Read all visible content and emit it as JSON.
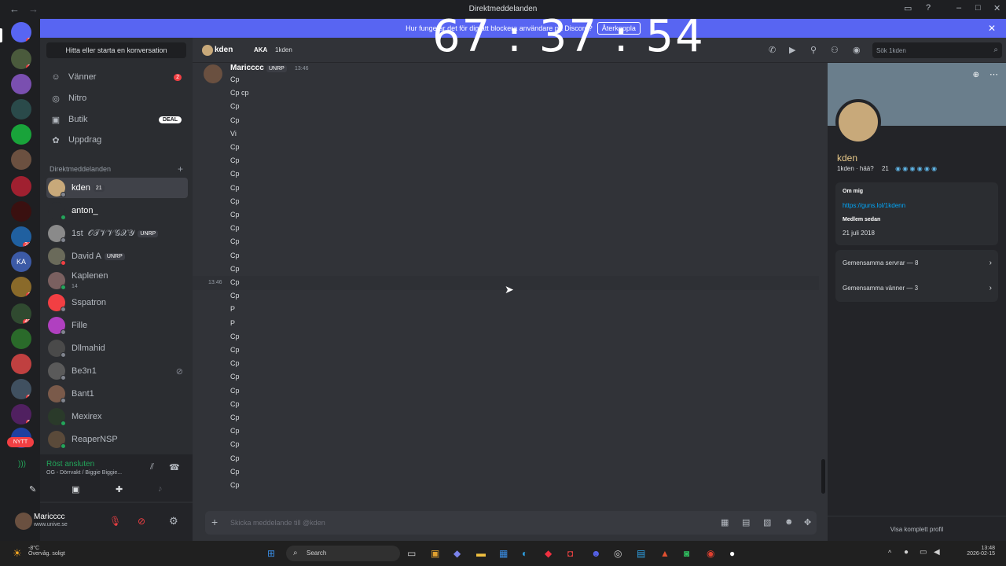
{
  "window": {
    "title": "Direktmeddelanden",
    "back": "←",
    "forward": "→"
  },
  "banner": {
    "text": "Hur fungerar det för dig att blockera användare på Discord?",
    "button": "Återkoppla"
  },
  "overlay_clock": "67 : 37 : 54",
  "rail": {
    "badges": [
      "2",
      "1",
      "34",
      "1",
      "49",
      "8",
      "5"
    ],
    "ka_label": "KA",
    "new_label": "NYTT"
  },
  "dm_panel": {
    "find_label": "Hitta eller starta en konversation",
    "nav": [
      {
        "label": "Vänner",
        "icon": "friends-icon",
        "badge": "2"
      },
      {
        "label": "Nitro",
        "icon": "nitro-icon"
      },
      {
        "label": "Butik",
        "icon": "shop-icon",
        "deal": "DEAL"
      },
      {
        "label": "Uppdrag",
        "icon": "quests-icon"
      }
    ],
    "header": "Direktmeddelanden",
    "items": [
      {
        "name": "kden",
        "tag": "21"
      },
      {
        "name": "anton_"
      },
      {
        "name": "1st  𝒪𝒯𝒱𝒱𝒢𝒳𝒴",
        "tag": "UNRP"
      },
      {
        "name": "David A",
        "tag": "UNRP"
      },
      {
        "name": "Kaplenen",
        "sub": "14"
      },
      {
        "name": "Sspatron"
      },
      {
        "name": "Fille"
      },
      {
        "name": "Dllmahid"
      },
      {
        "name": "Be3n1"
      },
      {
        "name": "Bant1"
      },
      {
        "name": "Mexirex"
      },
      {
        "name": "ReaperNSP"
      }
    ]
  },
  "voice": {
    "status": "Röst ansluten",
    "channel": "OG - Dörrvakt / Biggie Biggie..."
  },
  "user": {
    "name": "Maricccc",
    "status": "www.unive.se"
  },
  "chat_header": {
    "name": "kden",
    "aka": "AKA",
    "aka_name": "1kden",
    "search_placeholder": "Sök 1kden"
  },
  "messages": {
    "author": "Maricccc",
    "author_tag": "UNRP",
    "time": "13:46",
    "hover_time": "13:46",
    "lines": [
      "Cp",
      "Cp cp",
      "Cp",
      "Cp",
      "Vi",
      "Cp",
      "Cp",
      "Cp",
      "Cp",
      "Cp",
      "Cp",
      "Cp",
      "Cp",
      "Cp",
      "Cp",
      "Cp",
      "Cp",
      "P",
      "P",
      "Cp",
      "Cp",
      "Cp",
      "Cp",
      "Cp",
      "Cp",
      "Cp",
      "Cp",
      "Cp",
      "Cp",
      "Cp",
      "Cp"
    ]
  },
  "composer": {
    "placeholder": "Skicka meddelande till @kden"
  },
  "profile": {
    "name": "kden",
    "username": "1kden · hää?",
    "boost": "21",
    "about_label": "Om mig",
    "about_link": "https://guns.lol/1kdenn",
    "member_label": "Medlem sedan",
    "member_date": "21 juli 2018",
    "mutual_servers": "Gemensamma servrar — 8",
    "mutual_friends": "Gemensamma vänner — 3",
    "full_profile": "Visa komplett profil"
  },
  "taskbar": {
    "weather_temp": "-8°C",
    "weather_desc": "Övervåg. soligt",
    "search": "Search",
    "time": "13:48",
    "date": "2026-02-15"
  }
}
